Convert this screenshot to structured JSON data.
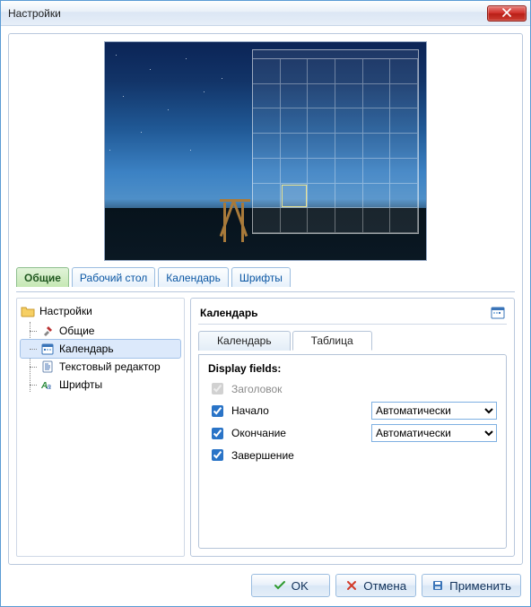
{
  "window": {
    "title": "Настройки"
  },
  "tabs": {
    "items": [
      "Общие",
      "Рабочий стол",
      "Календарь",
      "Шрифты"
    ],
    "active_index": 0
  },
  "tree": {
    "root": "Настройки",
    "items": [
      {
        "label": "Общие",
        "icon": "tools-icon"
      },
      {
        "label": "Календарь",
        "icon": "calendar-small-icon",
        "selected": true
      },
      {
        "label": "Текстовый редактор",
        "icon": "document-icon"
      },
      {
        "label": "Шрифты",
        "icon": "font-icon"
      }
    ]
  },
  "panel": {
    "title": "Календарь",
    "tabs": [
      "Календарь",
      "Таблица"
    ],
    "active_tab_index": 1,
    "fields_header": "Display fields:",
    "fields": [
      {
        "label": "Заголовок",
        "checked": true,
        "enabled": false,
        "has_dropdown": false,
        "dropdown_value": ""
      },
      {
        "label": "Начало",
        "checked": true,
        "enabled": true,
        "has_dropdown": true,
        "dropdown_value": "Автоматически"
      },
      {
        "label": "Окончание",
        "checked": true,
        "enabled": true,
        "has_dropdown": true,
        "dropdown_value": "Автоматически"
      },
      {
        "label": "Завершение",
        "checked": true,
        "enabled": true,
        "has_dropdown": false,
        "dropdown_value": ""
      }
    ]
  },
  "buttons": {
    "ok": "OK",
    "cancel": "Отмена",
    "apply": "Применить"
  }
}
